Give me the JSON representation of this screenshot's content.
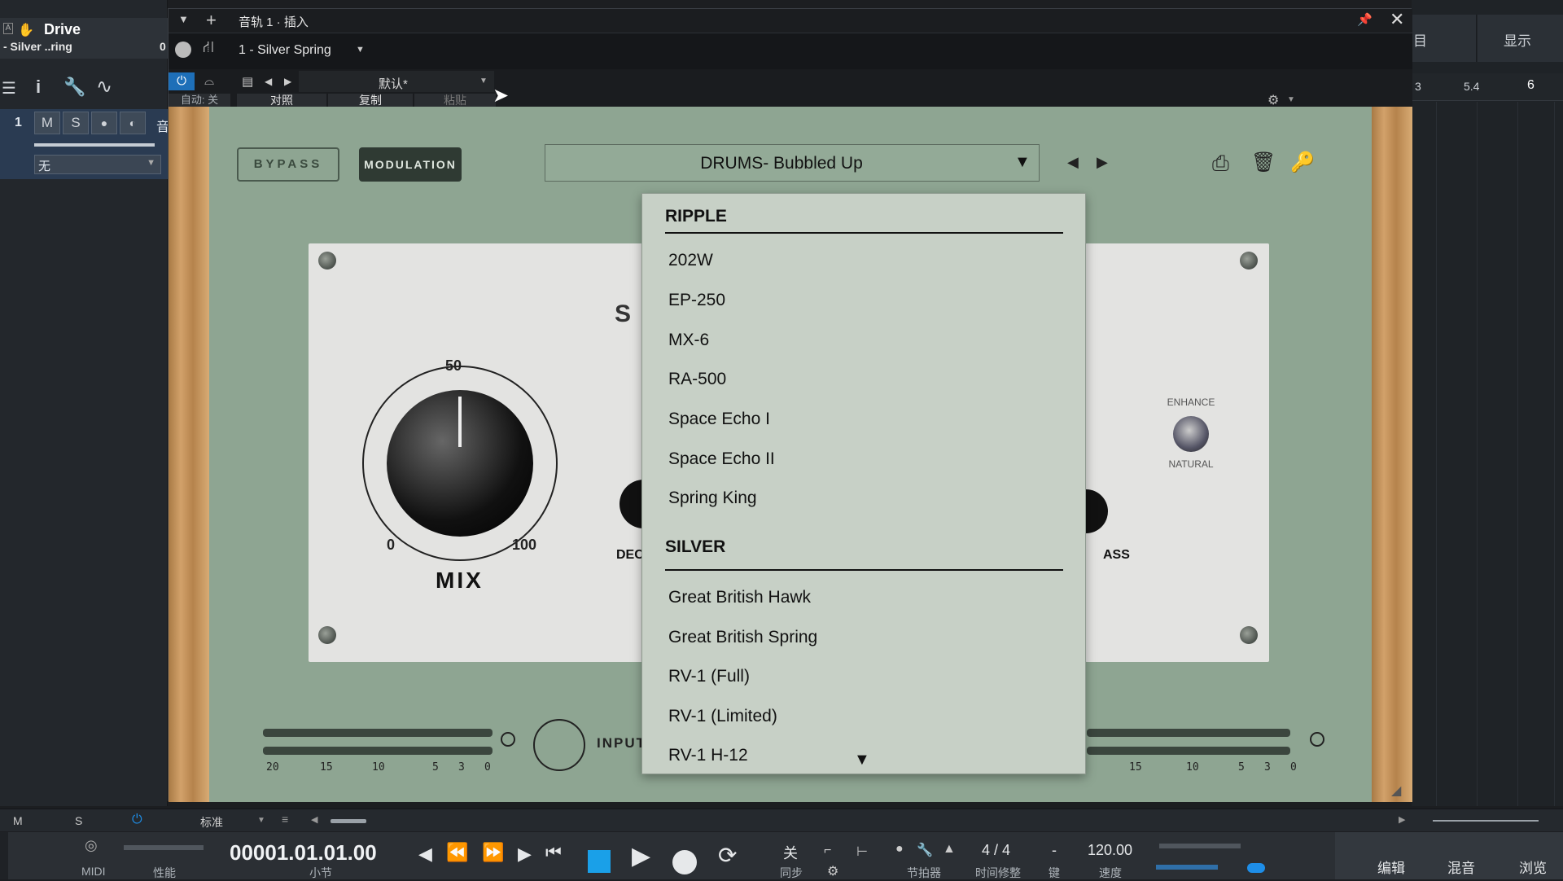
{
  "colors": {
    "accent_blue": "#1e8ee8",
    "plugin_green": "#8ea592",
    "menu_bg": "#c7d0c6",
    "wood": "#c9955d",
    "stop_blue": "#1aa0e8"
  },
  "left_panel": {
    "channel_title": "Drive",
    "channel_subtitle": "- Silver ..ring",
    "channel_value": "0",
    "track_number": "1",
    "track_m": "M",
    "track_s": "S",
    "track_name_fragment": "音",
    "track_dropdown": "无"
  },
  "plugin_window": {
    "title": "音轨 1 · 插入",
    "plugin_select": "1 - Silver Spring",
    "preset_name": "默认*",
    "auto_label": "自动: 关",
    "compare_label": "对照",
    "copy_label": "复制",
    "paste_label": "粘贴"
  },
  "plugin": {
    "bypass_label": "BYPASS",
    "modulation_label": "MODULATION",
    "preset_display": "DRUMS- Bubbled Up",
    "mix_label": "MIX",
    "mix_scale": {
      "min": "0",
      "mid": "50",
      "max": "100"
    },
    "logo_fragment": "S",
    "decay_fragment": "DEC",
    "bass_fragment": "ASS",
    "enhance_label": "ENHANCE",
    "natural_label": "NATURAL",
    "input_label": "INPUT",
    "meter_left_ticks": [
      "20",
      "15",
      "10",
      "5",
      "3",
      "0"
    ],
    "meter_right_ticks": [
      "15",
      "10",
      "5",
      "3",
      "0"
    ]
  },
  "preset_menu": {
    "sections": [
      {
        "header": "RIPPLE",
        "items": [
          "202W",
          "EP-250",
          "MX-6",
          "RA-500",
          "Space Echo I",
          "Space Echo II",
          "Spring King"
        ]
      },
      {
        "header": "SILVER",
        "items": [
          "Great British Hawk",
          "Great British Spring",
          "RV-1 (Full)",
          "RV-1 (Limited)",
          "RV-1 H-12"
        ]
      }
    ]
  },
  "right_panel": {
    "tab_partial": "目",
    "tab_display": "显示",
    "ruler_marks": [
      "3",
      "5.4",
      "6"
    ]
  },
  "bottom_bar": {
    "m_label": "M",
    "s_label": "S",
    "mode_label": "标准"
  },
  "transport": {
    "midi_label": "MIDI",
    "perf_label": "性能",
    "time_display": "00001.01.01.00",
    "time_unit": "小节",
    "sync_value": "关",
    "sync_label": "同步",
    "metronome_label": "节拍器",
    "time_sig_value": "4 / 4",
    "time_sig_label": "时间修整",
    "key_value": "-",
    "key_label": "键",
    "tempo_value": "120.00",
    "tempo_label": "速度",
    "tab_edit": "编辑",
    "tab_mix": "混音",
    "tab_browse": "浏览"
  }
}
